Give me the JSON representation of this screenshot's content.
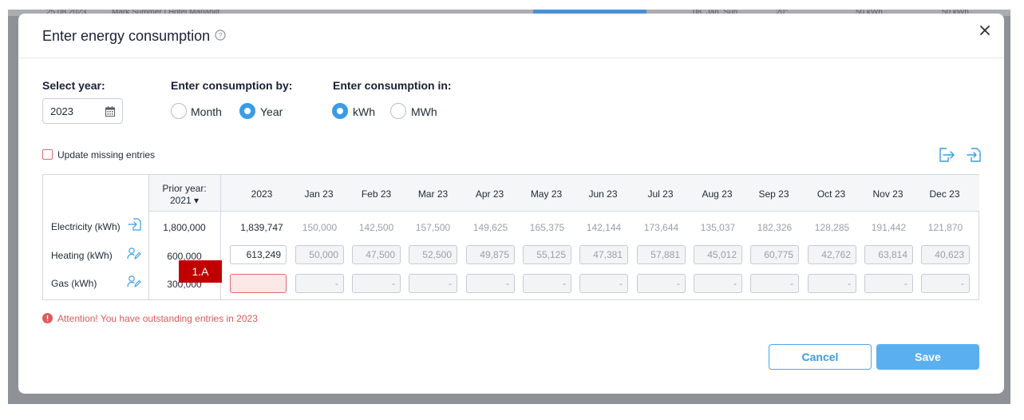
{
  "background": {
    "items": [
      "25.08.2023",
      "Mark Summer | Hotel Mariahilf",
      "08. Jan. Sun",
      "20°",
      "50 kWh",
      "50 kWh"
    ]
  },
  "modal": {
    "title": "Enter energy consumption",
    "help_icon": "help-circle-icon",
    "close_icon": "close-icon"
  },
  "select_year": {
    "label": "Select year:",
    "value": "2023",
    "icon": "calendar-icon"
  },
  "consumption_by": {
    "label": "Enter consumption by:",
    "options": [
      {
        "label": "Month",
        "checked": false
      },
      {
        "label": "Year",
        "checked": true
      }
    ]
  },
  "consumption_in": {
    "label": "Enter consumption in:",
    "options": [
      {
        "label": "kWh",
        "checked": true
      },
      {
        "label": "MWh",
        "checked": false
      }
    ]
  },
  "update_missing": {
    "label": "Update missing entries",
    "checked": false
  },
  "toolbar": {
    "export_icon": "export-icon",
    "import_icon": "import-icon"
  },
  "table": {
    "prior_year_label": "Prior year:",
    "prior_year_value": "2021 ▾",
    "year_column": "2023",
    "months": [
      "Jan 23",
      "Feb 23",
      "Mar 23",
      "Apr 23",
      "May 23",
      "Jun 23",
      "Jul 23",
      "Aug 23",
      "Sep 23",
      "Oct 23",
      "Nov 23",
      "Dec 23"
    ],
    "rows": [
      {
        "label": "Electricity (kWh)",
        "icon": "import-file-icon",
        "prior": "1,800,000",
        "total": "1,839,747",
        "editable": false,
        "monthly": [
          "150,000",
          "142,500",
          "157,500",
          "149,625",
          "165,375",
          "142,144",
          "173,644",
          "135,037",
          "182,326",
          "128,285",
          "191,442",
          "121,870"
        ]
      },
      {
        "label": "Heating (kWh)",
        "icon": "user-edit-icon",
        "prior": "600,000",
        "total": "613,249",
        "editable": true,
        "monthly": [
          "50,000",
          "47,500",
          "52,500",
          "49,875",
          "55,125",
          "47,381",
          "57,881",
          "45,012",
          "60,775",
          "42,762",
          "63,814",
          "40,623"
        ]
      },
      {
        "label": "Gas (kWh)",
        "icon": "user-edit-icon",
        "prior": "300,000",
        "total": "",
        "editable": true,
        "monthly": [
          "-",
          "-",
          "-",
          "-",
          "-",
          "-",
          "-",
          "-",
          "-",
          "-",
          "-",
          "-"
        ]
      }
    ]
  },
  "annotation_tag": "1.A",
  "warning": {
    "text": "Attention! You have outstanding entries in 2023",
    "icon": "alert-circle-icon",
    "color": "#e05a5a"
  },
  "actions": {
    "cancel": "Cancel",
    "save": "Save"
  },
  "colors": {
    "accent": "#3a9ce6",
    "error": "#e46a6a",
    "tag": "#c00000"
  }
}
